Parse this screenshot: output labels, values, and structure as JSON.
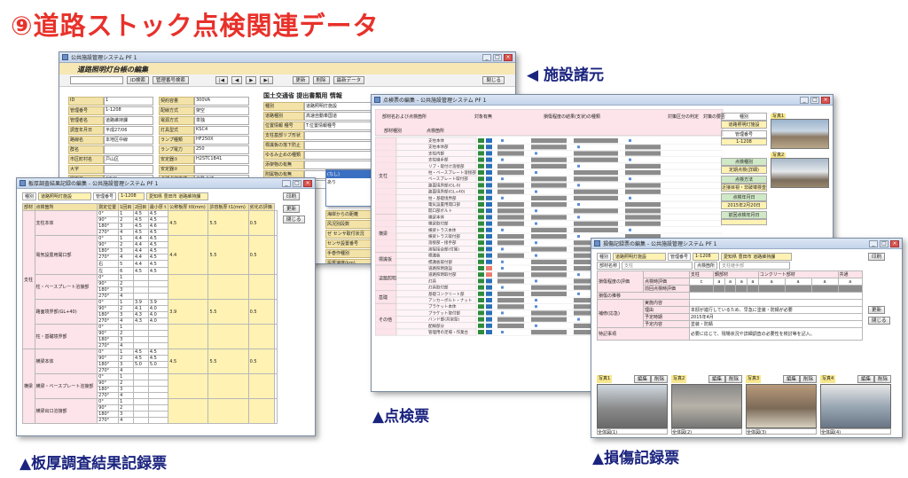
{
  "headline": "⑨道路ストック点検関連データ",
  "captions": {
    "spec": "◀ 施設諸元",
    "inspection": "▲点検票",
    "thickness": "▲板厚調査結果記録票",
    "damage": "▲損傷記録票"
  },
  "win1": {
    "title": "公共施設管理システム PF 1",
    "heading": "道路照明灯台帳の編集",
    "btn_search_id": "ID検索",
    "btn_search_mgmt": "管理番号検索",
    "btn_update": "更新",
    "btn_delete": "削除",
    "btn_move": "最新データ",
    "btn_close": "閉じる",
    "section_mlit": "国土交通省  提出書類用  情報",
    "fields_left": [
      {
        "label": "ID",
        "value": "1"
      },
      {
        "label": "管理番号",
        "value": "1-1208"
      },
      {
        "label": "管理者名",
        "value": "道路維持課"
      },
      {
        "label": "調査年月日",
        "value": "平成27/06"
      },
      {
        "label": "路線名",
        "value": "本地区中線"
      },
      {
        "label": "群名",
        "value": ""
      },
      {
        "label": "市区町村名",
        "value": "戸山区"
      },
      {
        "label": "大字",
        "value": ""
      },
      {
        "label": "字丁目",
        "value": "2丁目"
      }
    ],
    "fields_mid": [
      {
        "label": "契約容量",
        "value": "300VA"
      },
      {
        "label": "配線方式",
        "value": "架空"
      },
      {
        "label": "電源方式",
        "value": "単独"
      },
      {
        "label": "灯具型式",
        "value": "KSC4"
      },
      {
        "label": "ランプ種類",
        "value": "HF250X"
      },
      {
        "label": "ランプ電力",
        "value": "250"
      },
      {
        "label": "安定器①",
        "value": "H2STC1B41"
      },
      {
        "label": "安定器②",
        "value": ""
      },
      {
        "label": "点滅点灯方式",
        "value": "自動点滅"
      }
    ],
    "fields_right": [
      {
        "label": "種別",
        "value": "道路照明灯施設"
      },
      {
        "label": "道路種別",
        "value": "高速自動車国道"
      },
      {
        "label": "位置情報 種号",
        "value": "T.位置情報種号"
      },
      {
        "label": "支柱基部リブ形状",
        "value": ""
      },
      {
        "label": "標識板の落下防止",
        "value": ""
      },
      {
        "label": "ゆるみ止めの種類",
        "value": ""
      },
      {
        "label": "添架物の有無",
        "value": ""
      },
      {
        "label": "附属物の有無",
        "value": ""
      },
      {
        "label": "Y",
        "value": ""
      }
    ],
    "extra": [
      {
        "label": "海岸からの距離",
        "value": ""
      },
      {
        "label": "风况別段数",
        "value": ""
      },
      {
        "label": "ぜ センサ取付状況",
        "value": ""
      },
      {
        "label": "センサ設置番号",
        "value": ""
      },
      {
        "label": "手巻作種別",
        "value": ""
      },
      {
        "label": "設置速度(km)",
        "value": "10"
      }
    ],
    "dropdown": [
      "(なし)",
      "あり"
    ]
  },
  "win2": {
    "title": "点検票の編集 - 公共施設管理システム PF 1",
    "header_cols": [
      "部材名および点検箇所",
      "対象有無",
      "損傷程度の結果(支状)の種類",
      "対策区分の判定",
      "対策の要否"
    ],
    "sub_cols": [
      "部材種別",
      "点検箇所"
    ],
    "groups": [
      {
        "name": "支柱",
        "rows": [
          "支柱本体",
          "支柱本体部",
          "支柱内部",
          "支柱継手部",
          "リブ・取付け溶接部",
          "柱・ベースプレート溶接部",
          "ベースプレート取付部",
          "路面境界部(GL-0)",
          "路面境界部(GL+40)",
          "柱・基礎境界部",
          "電気設置用開口部",
          "開口部ボルト"
        ]
      },
      {
        "name": "横梁",
        "rows": [
          "横梁本体",
          "横梁取付部",
          "横梁トラス本体",
          "横梁トラス取付部",
          "溶接部・接手部",
          "溶接接合部(付属)"
        ]
      },
      {
        "name": "標識板",
        "rows": [
          "標識板",
          "標識板取付部"
        ]
      },
      {
        "name": "道路照明",
        "rows": [
          "道路照明施設",
          "道路照明取付部",
          "灯具",
          "灯具取付部"
        ]
      },
      {
        "name": "基礎",
        "rows": [
          "基礎コンクリート部",
          "アンカーボルト・ナット"
        ]
      },
      {
        "name": "その他",
        "rows": [
          "ブラケット本体",
          "ブラケット取付部",
          "バンド部(共架型)",
          "配線部分",
          "管理用の足場・作業台"
        ]
      }
    ],
    "side": {
      "type_label": "種別",
      "type_value": "道路照明灯施設",
      "mgmt_label": "管理番号",
      "mgmt_value": "1-1208",
      "insp_kind_label": "点検種別",
      "insp_kind_value": "定期点検(詳細)",
      "method_label": "点検方法",
      "method_value": "近接目視・非破壊検査",
      "date_label": "点検年月日",
      "date_value": "2015年2月20日",
      "prev_label": "前回点検年月日",
      "prev_value": "",
      "photo1": "写真1",
      "photo2": "写真2"
    }
  },
  "win3": {
    "title": "板厚調査結果記録の編集 - 公共施設管理システム PF 1",
    "top": [
      "種別",
      "道路照明灯施設",
      "管理番号",
      "1-1208",
      "愛知県 豊田市 道路維持課"
    ],
    "btn_print": "印刷",
    "btn_update": "更新",
    "btn_close": "閉じる",
    "headers": [
      "部材",
      "点検箇所",
      "測定位置",
      "1回目",
      "2回目",
      "最小厚 t",
      "公称板厚 t0(mm)",
      "許容板厚 t1(mm)",
      "劣化の評価"
    ],
    "groups": [
      {
        "name": "支柱",
        "parts": [
          {
            "label": "支柱本体",
            "rows": [
              [
                "0°",
                "1",
                "4.5",
                "4.5"
              ],
              [
                "90°",
                "2",
                "4.5",
                "4.5"
              ],
              [
                "180°",
                "3",
                "4.5",
                "4.6"
              ],
              [
                "270°",
                "4",
                "4.5",
                "4.5"
              ]
            ],
            "t": "4.5",
            "t0": "5.5",
            "t1": "0.5"
          },
          {
            "label": "電気設置用開口部",
            "rows": [
              [
                "0°",
                "1",
                "4.4",
                "4.5"
              ],
              [
                "90°",
                "2",
                "4.4",
                "4.5"
              ],
              [
                "180°",
                "3",
                "4.4",
                "4.5"
              ],
              [
                "270°",
                "4",
                "4.4",
                "4.5"
              ],
              [
                "右",
                "5",
                "4.4",
                "4.5"
              ],
              [
                "左",
                "6",
                "4.5",
                "4.5"
              ]
            ],
            "t": "4.4",
            "t0": "5.5",
            "t1": "0.5"
          },
          {
            "label": "柱・ベースプレート溶接部",
            "rows": [
              [
                "0°",
                "1",
                "",
                ""
              ],
              [
                "90°",
                "2",
                "",
                ""
              ],
              [
                "180°",
                "3",
                "",
                ""
              ],
              [
                "270°",
                "4",
                "",
                ""
              ]
            ],
            "t": "",
            "t0": "",
            "t1": ""
          },
          {
            "label": "路面境界部(GL+40)",
            "rows": [
              [
                "0°",
                "1",
                "3.9",
                "3.9"
              ],
              [
                "90°",
                "2",
                "4.1",
                "4.0"
              ],
              [
                "180°",
                "3",
                "4.3",
                "4.0"
              ],
              [
                "270°",
                "4",
                "4.3",
                "4.0"
              ]
            ],
            "t": "3.9",
            "t0": "5.5",
            "t1": "0.5"
          },
          {
            "label": "柱・基礎境界部",
            "rows": [
              [
                "0°",
                "1",
                "",
                ""
              ],
              [
                "90°",
                "2",
                "",
                ""
              ],
              [
                "180°",
                "3",
                "",
                ""
              ],
              [
                "270°",
                "4",
                "",
                ""
              ]
            ],
            "t": "",
            "t0": "",
            "t1": ""
          }
        ]
      },
      {
        "name": "横梁",
        "parts": [
          {
            "label": "横梁本体",
            "rows": [
              [
                "0°",
                "1",
                "4.5",
                "4.5"
              ],
              [
                "90°",
                "2",
                "4.5",
                "4.5"
              ],
              [
                "180°",
                "3",
                "5.0",
                "5.0"
              ],
              [
                "270°",
                "4",
                "",
                ""
              ]
            ],
            "t": "4.5",
            "t0": "5.5",
            "t1": "0.5"
          },
          {
            "label": "横梁・ベースプレート溶接部",
            "rows": [
              [
                "0°",
                "1",
                "",
                ""
              ],
              [
                "90°",
                "2",
                "",
                ""
              ],
              [
                "180°",
                "3",
                "",
                ""
              ],
              [
                "270°",
                "4",
                "",
                ""
              ]
            ],
            "t": "",
            "t0": "",
            "t1": ""
          },
          {
            "label": "横梁出口溶接部",
            "rows": [
              [
                "0°",
                "1",
                "",
                ""
              ],
              [
                "90°",
                "2",
                "",
                ""
              ],
              [
                "180°",
                "3",
                "",
                ""
              ],
              [
                "270°",
                "4",
                "",
                ""
              ]
            ],
            "t": "",
            "t0": "",
            "t1": ""
          }
        ]
      }
    ]
  },
  "win4": {
    "title": "損傷記録票の編集 - 公共施設管理システム PF 1",
    "top": [
      "種別",
      "道路照明灯施設",
      "管理番号",
      "1-1208",
      "愛知県 豊田市 道路維持課"
    ],
    "btn_print": "印刷",
    "btn_update": "更新",
    "btn_close": "閉じる",
    "part_label": "部材名称",
    "part_value": "支柱",
    "spot_label": "点検箇所",
    "spot_value": "支柱継手部",
    "row_labels": [
      "損傷程度の評価",
      "点検時評価",
      "前回点検時評価",
      "損傷の推移",
      "補修(応急)",
      "実施内容",
      "未実施",
      "理由",
      "予定時期",
      "予定内容",
      "特記事項"
    ],
    "cols": [
      "支柱",
      "鋼部材",
      "コンクリート部材",
      "共通"
    ],
    "subcols": [
      "腐食",
      "亀裂",
      "ゆるみ・脱落",
      "破断",
      "変形・欠損",
      "ひびわれ",
      "うき・剥離",
      "漏水",
      "その他"
    ],
    "grades": [
      "c",
      "a",
      "a",
      "a",
      "a",
      "a",
      "a",
      "a",
      "a"
    ],
    "reason": "本邸が進行しているため、早急に塗装・防錆が必要",
    "date": "2015年4月",
    "content": "塗装・防錆",
    "note": "必要に応じて、現場状況や詳細調査の必要性を検討等を記入。",
    "photos": [
      {
        "label": "写真1",
        "cap": "全体図(1)"
      },
      {
        "label": "写真2",
        "cap": "全体図(2)"
      },
      {
        "label": "写真3",
        "cap": "全体図(3)"
      },
      {
        "label": "写真4",
        "cap": "全体図(4)"
      }
    ],
    "btn_edit": "編集",
    "btn_del": "削除"
  }
}
